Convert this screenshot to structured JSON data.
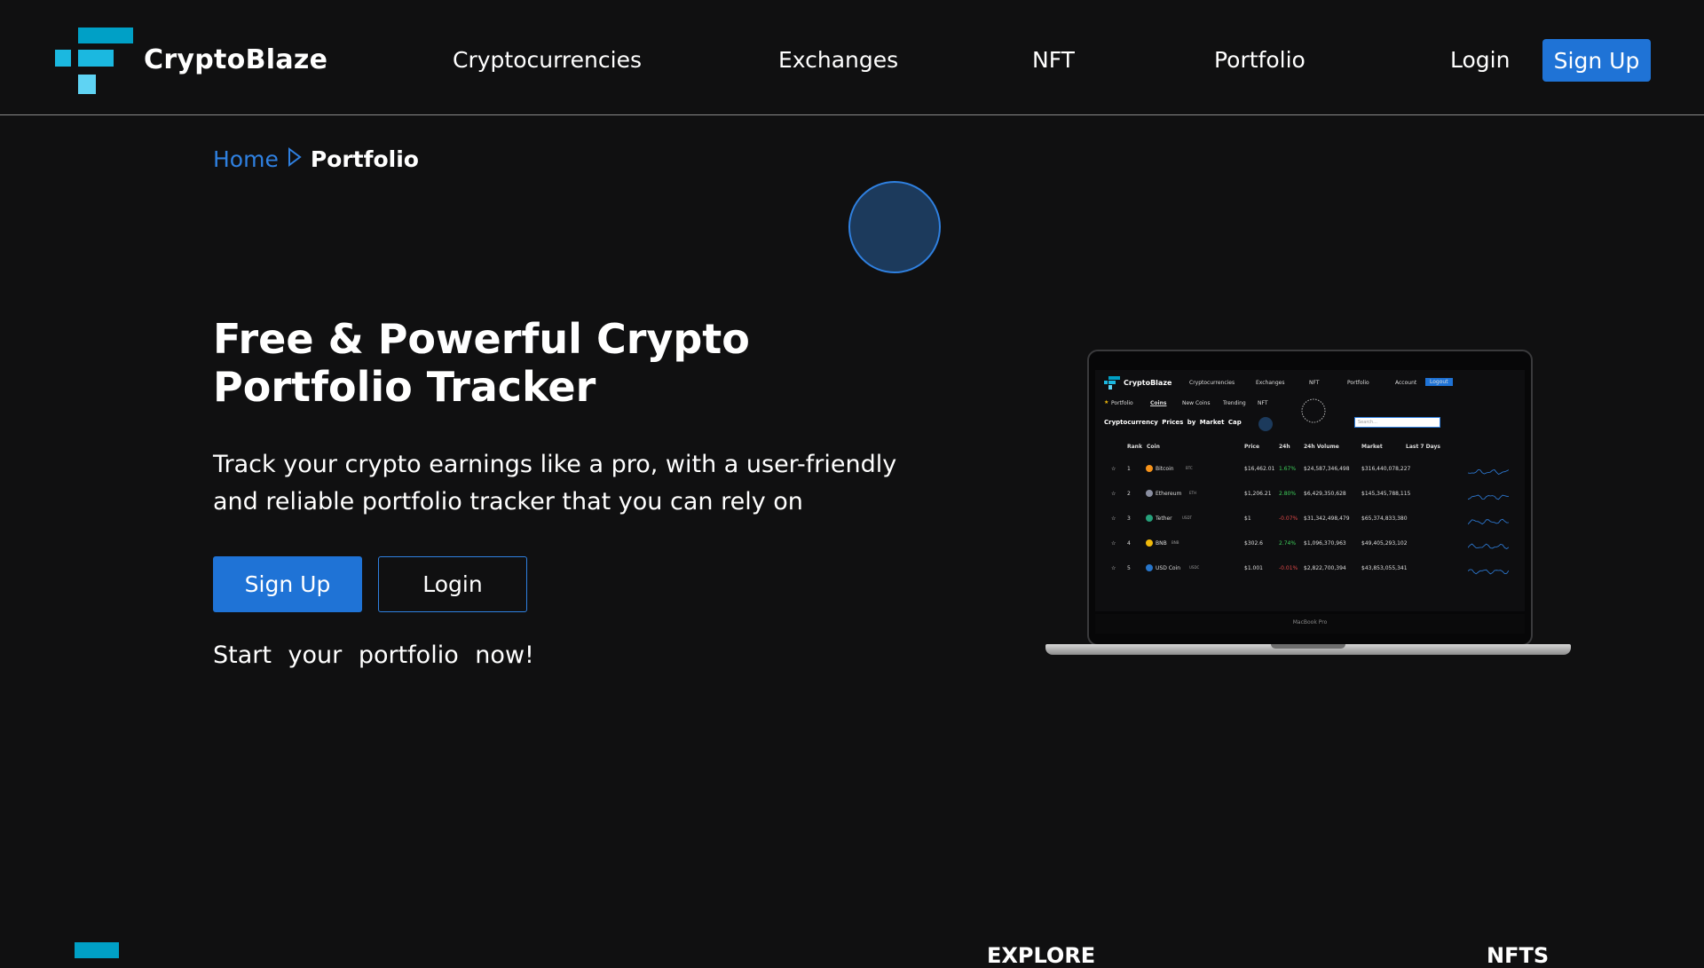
{
  "header": {
    "brand": "CryptoBlaze",
    "nav": [
      "Cryptocurrencies",
      "Exchanges",
      "NFT",
      "Portfolio"
    ],
    "login_label": "Login",
    "signup_label": "Sign Up"
  },
  "breadcrumb": {
    "home": "Home",
    "current": "Portfolio"
  },
  "hero": {
    "title": "Free & Powerful Crypto Portfolio Tracker",
    "description": "Track your crypto earnings like a pro, with a user-friendly and reliable portfolio tracker that you can rely on",
    "signup_label": "Sign Up",
    "login_label": "Login",
    "start_text": "Start your portfolio now!"
  },
  "laptop": {
    "model_label": "MacBook Pro",
    "screen": {
      "brand": "CryptoBlaze",
      "nav": [
        "Cryptocurrencies",
        "Exchanges",
        "NFT",
        "Portfolio"
      ],
      "account_label": "Account",
      "logout_label": "Logout",
      "tabs": [
        "Portfolio",
        "Coins",
        "New Coins",
        "Trending",
        "NFT"
      ],
      "heading": "Cryptocurrency Prices by Market Cap",
      "search_placeholder": "Search...",
      "columns": [
        "Rank",
        "Coin",
        "Price",
        "24h",
        "24h Volume",
        "Market",
        "Last 7 Days"
      ],
      "rows": [
        {
          "rank": "1",
          "coin": "Bitcoin",
          "symbol": "BTC",
          "price": "$16,462.01",
          "change": "1.67%",
          "volume": "$24,587,346,498",
          "market": "$316,440,078,227",
          "up": true
        },
        {
          "rank": "2",
          "coin": "Ethereum",
          "symbol": "ETH",
          "price": "$1,206.21",
          "change": "2.80%",
          "volume": "$6,429,350,628",
          "market": "$145,345,788,115",
          "up": true
        },
        {
          "rank": "3",
          "coin": "Tether",
          "symbol": "USDT",
          "price": "$1",
          "change": "-0.07%",
          "volume": "$31,342,498,479",
          "market": "$65,374,833,380",
          "up": false
        },
        {
          "rank": "4",
          "coin": "BNB",
          "symbol": "BNB",
          "price": "$302.6",
          "change": "2.74%",
          "volume": "$1,096,370,963",
          "market": "$49,405,293,102",
          "up": true
        },
        {
          "rank": "5",
          "coin": "USD Coin",
          "symbol": "USDC",
          "price": "$1.001",
          "change": "-0.01%",
          "volume": "$2,822,700,394",
          "market": "$43,853,055,341",
          "up": false
        }
      ]
    }
  },
  "footer": {
    "columns": [
      "EXPLORE",
      "NFTS"
    ]
  },
  "colors": {
    "background": "#101011",
    "accent": "#1f73d6",
    "link": "#2f80e0",
    "logo_cyan": "#00a0c6",
    "positive": "#3ecf5a",
    "negative": "#e04848"
  }
}
